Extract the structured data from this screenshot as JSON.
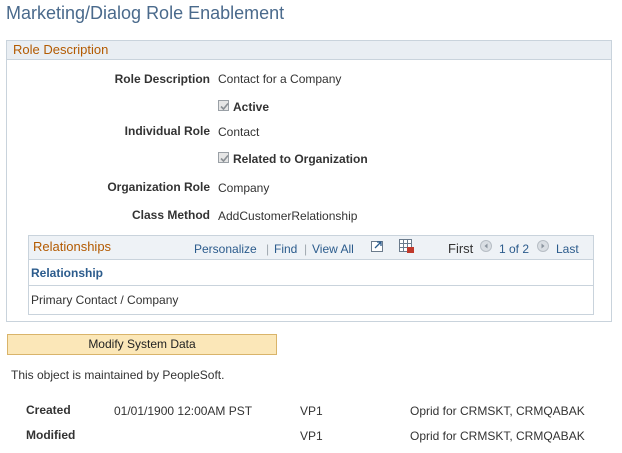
{
  "page": {
    "title": "Marketing/Dialog Role Enablement"
  },
  "role_section": {
    "title": "Role Description",
    "role_description_label": "Role Description",
    "role_description_value": "Contact for a Company",
    "active_label": "Active",
    "individual_role_label": "Individual Role",
    "individual_role_value": "Contact",
    "related_label": "Related to Organization",
    "organization_role_label": "Organization Role",
    "organization_role_value": "Company",
    "class_method_label": "Class Method",
    "class_method_value": "AddCustomerRelationship"
  },
  "relationships": {
    "title": "Relationships",
    "personalize": "Personalize",
    "find": "Find",
    "view_all": "View All",
    "sep": "|",
    "first": "First",
    "range": "1 of 2",
    "last": "Last",
    "column_header": "Relationship",
    "rows": [
      "Primary Contact / Company"
    ]
  },
  "actions": {
    "modify_label": "Modify System Data"
  },
  "notes": {
    "maintained": "This object is maintained by PeopleSoft."
  },
  "audit": {
    "created_label": "Created",
    "created_date": "01/01/1900 12:00AM PST",
    "created_version": "VP1",
    "created_oprid": "Oprid for CRMSKT, CRMQABAK",
    "modified_label": "Modified",
    "modified_version": "VP1",
    "modified_oprid": "Oprid for CRMSKT, CRMQABAK"
  }
}
